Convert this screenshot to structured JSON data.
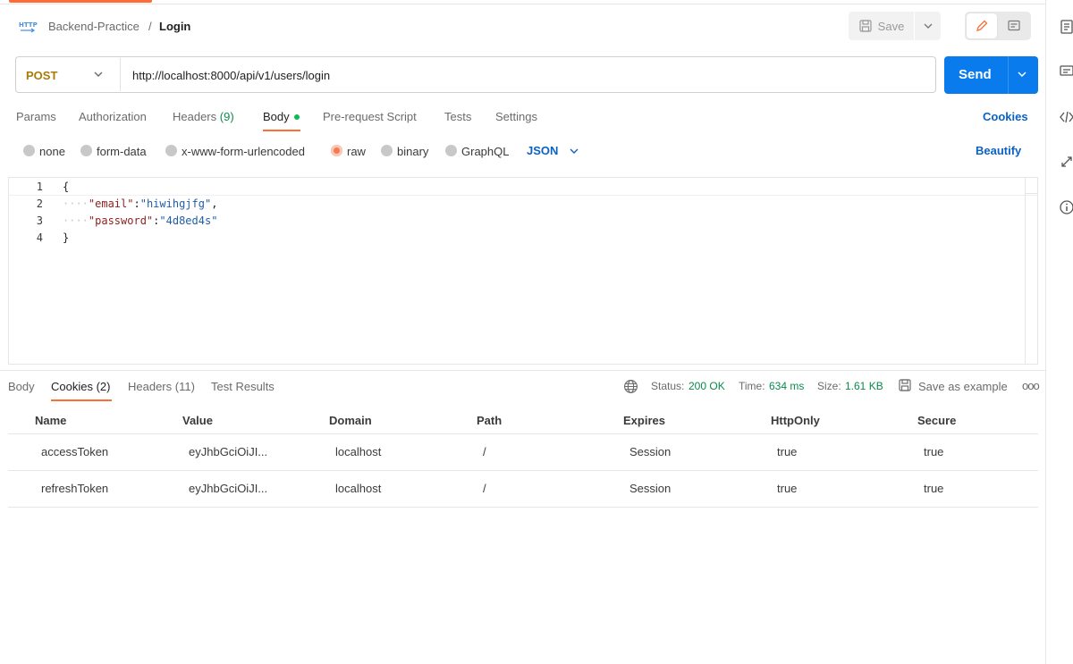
{
  "header": {
    "workspace": "Backend-Practice",
    "separator": "/",
    "request_name": "Login",
    "save_label": "Save"
  },
  "request": {
    "method": "POST",
    "url": "http://localhost:8000/api/v1/users/login",
    "send_label": "Send"
  },
  "request_tabs": {
    "params": "Params",
    "authorization": "Authorization",
    "headers": "Headers",
    "headers_count": "(9)",
    "body": "Body",
    "prerequest": "Pre-request Script",
    "tests": "Tests",
    "settings": "Settings",
    "cookies": "Cookies"
  },
  "body_modes": {
    "none": "none",
    "form_data": "form-data",
    "urlencoded": "x-www-form-urlencoded",
    "raw": "raw",
    "binary": "binary",
    "graphql": "GraphQL",
    "language": "JSON",
    "beautify": "Beautify"
  },
  "editor": {
    "line_numbers": [
      "1",
      "2",
      "3",
      "4"
    ],
    "line1": "{",
    "line2_key": "\"email\"",
    "line2_colon": ":",
    "line2_value": "\"hiwihgjfg\"",
    "line2_comma": ",",
    "line3_key": "\"password\"",
    "line3_colon": ":",
    "line3_value": "\"4d8ed4s\"",
    "line4": "}",
    "indent_dots": "····"
  },
  "response_tabs": {
    "body": "Body",
    "cookies": "Cookies",
    "cookies_count": "(2)",
    "headers": "Headers",
    "headers_count": "(11)",
    "test_results": "Test Results"
  },
  "response_meta": {
    "status_label": "Status:",
    "status_value": "200 OK",
    "time_label": "Time:",
    "time_value": "634 ms",
    "size_label": "Size:",
    "size_value": "1.61 KB",
    "save_example": "Save as example",
    "more": "ooo"
  },
  "cookies_table": {
    "columns": [
      "Name",
      "Value",
      "Domain",
      "Path",
      "Expires",
      "HttpOnly",
      "Secure"
    ],
    "rows": [
      [
        "accessToken",
        "eyJhbGciOiJI...",
        "localhost",
        "/",
        "Session",
        "true",
        "true"
      ],
      [
        "refreshToken",
        "eyJhbGciOiJI...",
        "localhost",
        "/",
        "Session",
        "true",
        "true"
      ]
    ]
  },
  "colors": {
    "accent": "#ff6c37",
    "send": "#097bed",
    "method": "#a97b09",
    "link": "#0b62c4",
    "status_ok": "#0c8a4e"
  }
}
